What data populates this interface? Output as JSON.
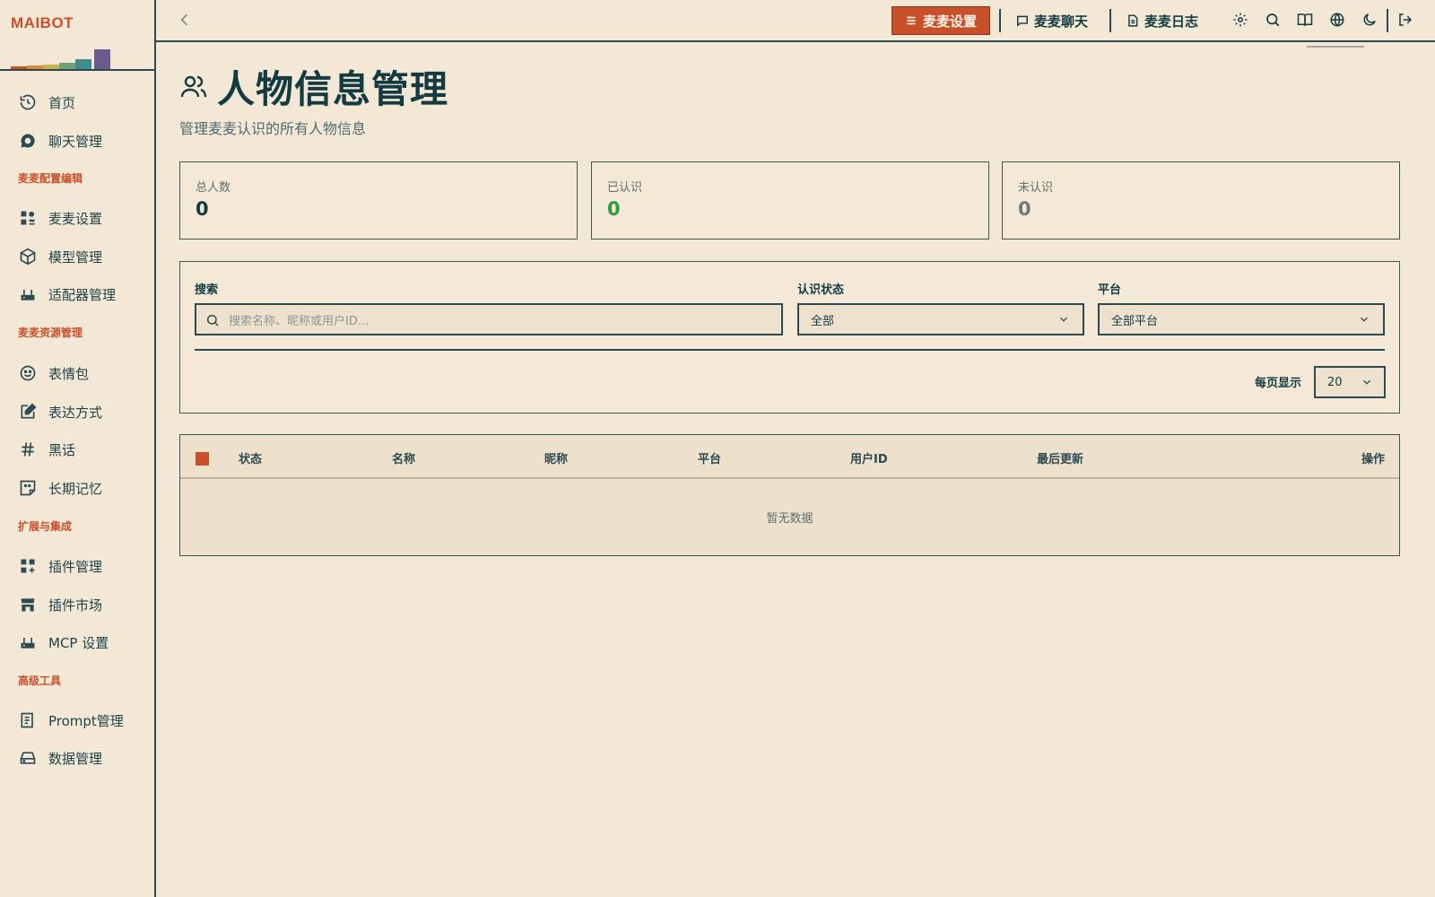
{
  "app": {
    "logo_text": "MAIBOT"
  },
  "sidebar": {
    "items": [
      {
        "label": "首页",
        "icon": "home-history-icon"
      },
      {
        "label": "聊天管理",
        "icon": "chat-bubble-icon"
      },
      {
        "label": "麦麦设置",
        "icon": "shapes-icon"
      },
      {
        "label": "模型管理",
        "icon": "cube-icon"
      },
      {
        "label": "适配器管理",
        "icon": "router-icon"
      },
      {
        "label": "表情包",
        "icon": "smile-icon"
      },
      {
        "label": "表达方式",
        "icon": "edit-square-icon"
      },
      {
        "label": "黑话",
        "icon": "hash-icon"
      },
      {
        "label": "长期记忆",
        "icon": "sticky-note-icon"
      },
      {
        "label": "插件管理",
        "icon": "grid-plus-icon"
      },
      {
        "label": "插件市场",
        "icon": "store-icon"
      },
      {
        "label": "MCP 设置",
        "icon": "router-icon"
      },
      {
        "label": "Prompt管理",
        "icon": "clipboard-list-icon"
      },
      {
        "label": "数据管理",
        "icon": "hard-drive-icon"
      }
    ],
    "sections": [
      "麦麦配置编辑",
      "麦麦资源管理",
      "扩展与集成",
      "高级工具"
    ]
  },
  "topbar": {
    "buttons": [
      {
        "label": "麦麦设置",
        "icon": "sliders-icon",
        "active": true
      },
      {
        "label": "麦麦聊天",
        "icon": "message-square-icon"
      },
      {
        "label": "麦麦日志",
        "icon": "file-text-icon"
      }
    ],
    "tools": [
      "gear-icon",
      "search-icon",
      "book-icon",
      "globe-icon",
      "moon-icon",
      "logout-icon"
    ]
  },
  "page": {
    "title": "人物信息管理",
    "subtitle": "管理麦麦认识的所有人物信息"
  },
  "stats": [
    {
      "label": "总人数",
      "value": "0",
      "color": "#143a42"
    },
    {
      "label": "已认识",
      "value": "0",
      "color": "#2e9b3e"
    },
    {
      "label": "未认识",
      "value": "0",
      "color": "#6b7a7c"
    }
  ],
  "filters": {
    "search_label": "搜索",
    "search_placeholder": "搜索名称、昵称或用户ID...",
    "status_label": "认识状态",
    "status_value": "全部",
    "platform_label": "平台",
    "platform_value": "全部平台",
    "per_page_label": "每页显示",
    "per_page_value": "20"
  },
  "table": {
    "columns": [
      "状态",
      "名称",
      "昵称",
      "平台",
      "用户ID",
      "最后更新",
      "操作"
    ],
    "empty_text": "暂无数据"
  },
  "colors": {
    "accent": "#c8502a",
    "ink": "#143a42",
    "background": "#f3e8d6"
  }
}
